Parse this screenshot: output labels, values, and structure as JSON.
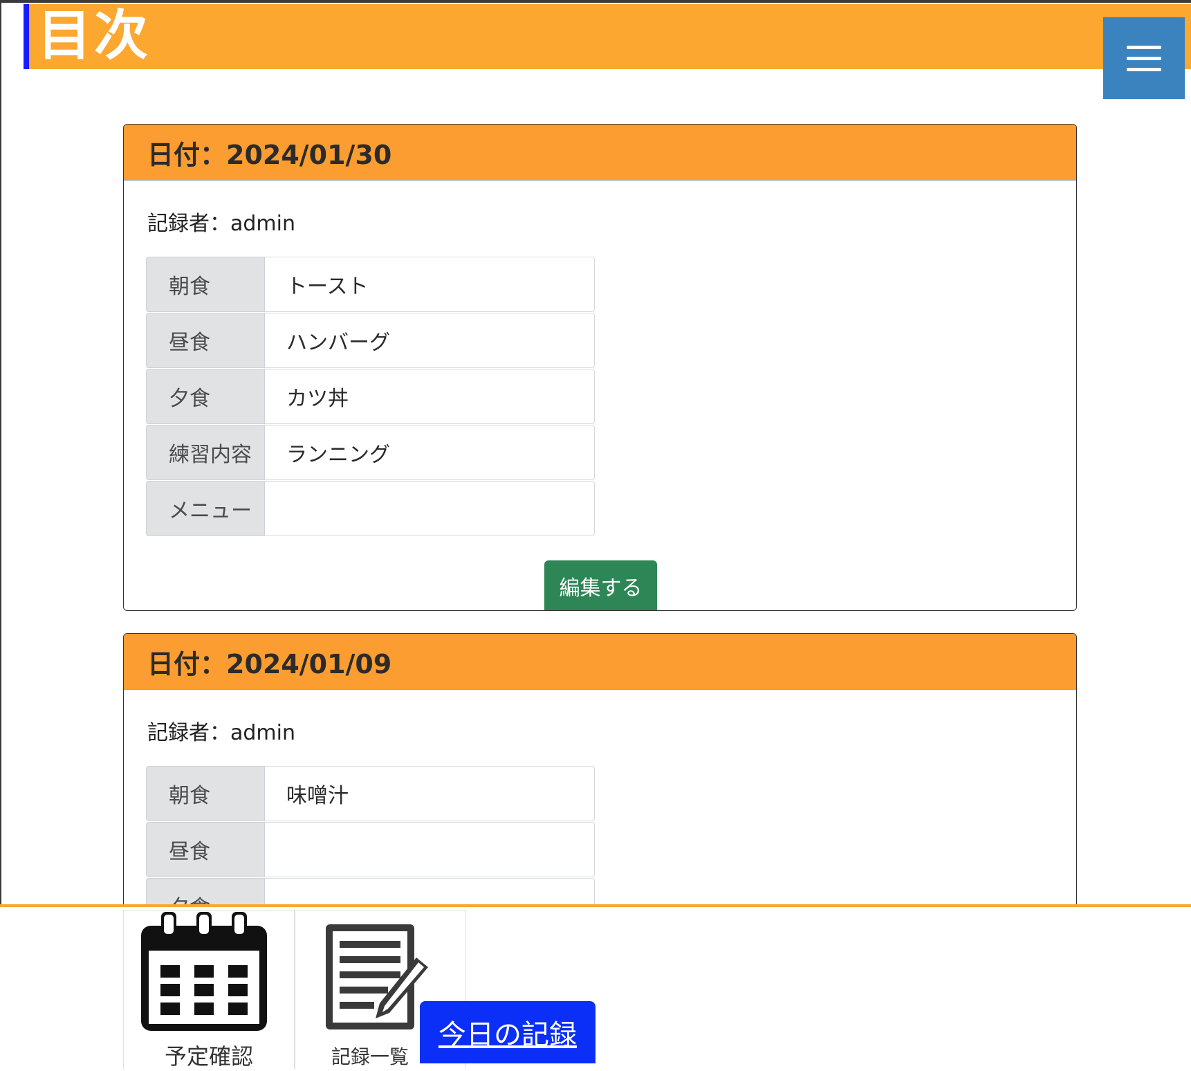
{
  "header": {
    "title": "目次",
    "menu_icon": "hamburger-menu-icon"
  },
  "colors": {
    "header_bg": "#fba730",
    "header_accent": "#1a1aff",
    "menu_button_bg": "#3b83be",
    "card_header_bg": "#fb9d30",
    "label_bg": "#e1e2e4",
    "edit_button_bg": "#2e8656",
    "today_button_bg": "#0b2ff7"
  },
  "entries": [
    {
      "date_label": "日付：2024/01/30",
      "recorder_label": "記録者：admin",
      "rows": [
        {
          "label": "朝食",
          "value": "トースト"
        },
        {
          "label": "昼食",
          "value": "ハンバーグ"
        },
        {
          "label": "夕食",
          "value": "カツ丼"
        },
        {
          "label": "練習内容",
          "value": "ランニング"
        },
        {
          "label": "メニュー",
          "value": ""
        }
      ],
      "edit_label": "編集する"
    },
    {
      "date_label": "日付：2024/01/09",
      "recorder_label": "記録者：admin",
      "rows": [
        {
          "label": "朝食",
          "value": "味噌汁"
        },
        {
          "label": "昼食",
          "value": ""
        },
        {
          "label": "夕食",
          "value": ""
        }
      ]
    }
  ],
  "footer": {
    "schedule_label": "予定確認",
    "schedule_icon": "calendar-icon",
    "records_label": "記録一覧",
    "records_icon": "document-edit-icon",
    "today_label": "今日の記録"
  }
}
